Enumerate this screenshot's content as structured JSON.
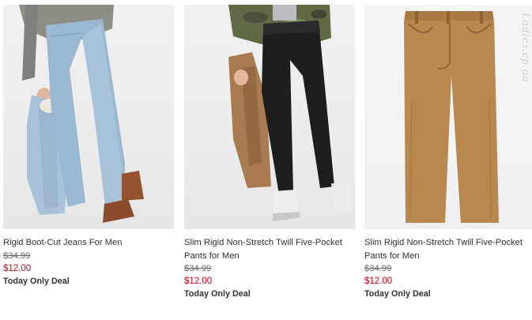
{
  "products": [
    {
      "name": "Rigid Boot-Cut Jeans For Men",
      "old_price": "$34.99",
      "price": "$12.00",
      "deal": "Today Only Deal"
    },
    {
      "name": "Slim Rigid Non-Stretch Twill Five-Pocket Pants for Men",
      "old_price": "$34.99",
      "price": "$12.00",
      "deal": "Today Only Deal"
    },
    {
      "name": "Slim Rigid Non-Stretch Twill Five-Pocket Pants for Men",
      "old_price": "$34.99",
      "price": "$12.00",
      "deal": "Today Only Deal"
    }
  ],
  "watermark": "Ladies.ep.aa",
  "colors": {
    "sale_price": "#d0021b",
    "text": "#333333",
    "light_wash_denim": "#9ab8d2",
    "black_twill": "#1e1e1e",
    "tan_twill": "#b8884f"
  }
}
